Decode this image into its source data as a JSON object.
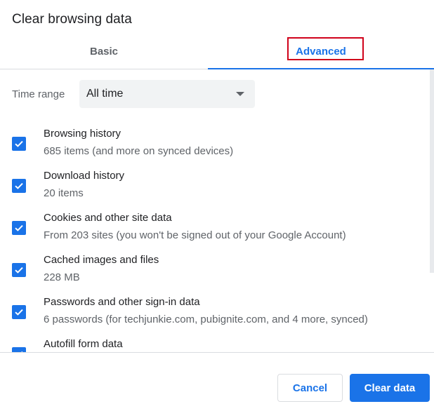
{
  "dialog": {
    "title": "Clear browsing data"
  },
  "tabs": [
    {
      "label": "Basic",
      "selected": false
    },
    {
      "label": "Advanced",
      "selected": true
    }
  ],
  "time_range": {
    "label": "Time range",
    "value": "All time"
  },
  "items": [
    {
      "title": "Browsing history",
      "subtitle": "685 items (and more on synced devices)",
      "checked": true
    },
    {
      "title": "Download history",
      "subtitle": "20 items",
      "checked": true
    },
    {
      "title": "Cookies and other site data",
      "subtitle": "From 203 sites (you won't be signed out of your Google Account)",
      "checked": true
    },
    {
      "title": "Cached images and files",
      "subtitle": "228 MB",
      "checked": true
    },
    {
      "title": "Passwords and other sign-in data",
      "subtitle": "6 passwords (for techjunkie.com, pubignite.com, and 4 more, synced)",
      "checked": true
    },
    {
      "title": "Autofill form data",
      "subtitle": "",
      "checked": true
    }
  ],
  "buttons": {
    "cancel": "Cancel",
    "clear": "Clear data"
  },
  "colors": {
    "accent": "#1a73e8",
    "highlight": "#d0021b"
  },
  "icons": {
    "checkbox": "check-icon",
    "dropdown": "caret-down-icon"
  }
}
